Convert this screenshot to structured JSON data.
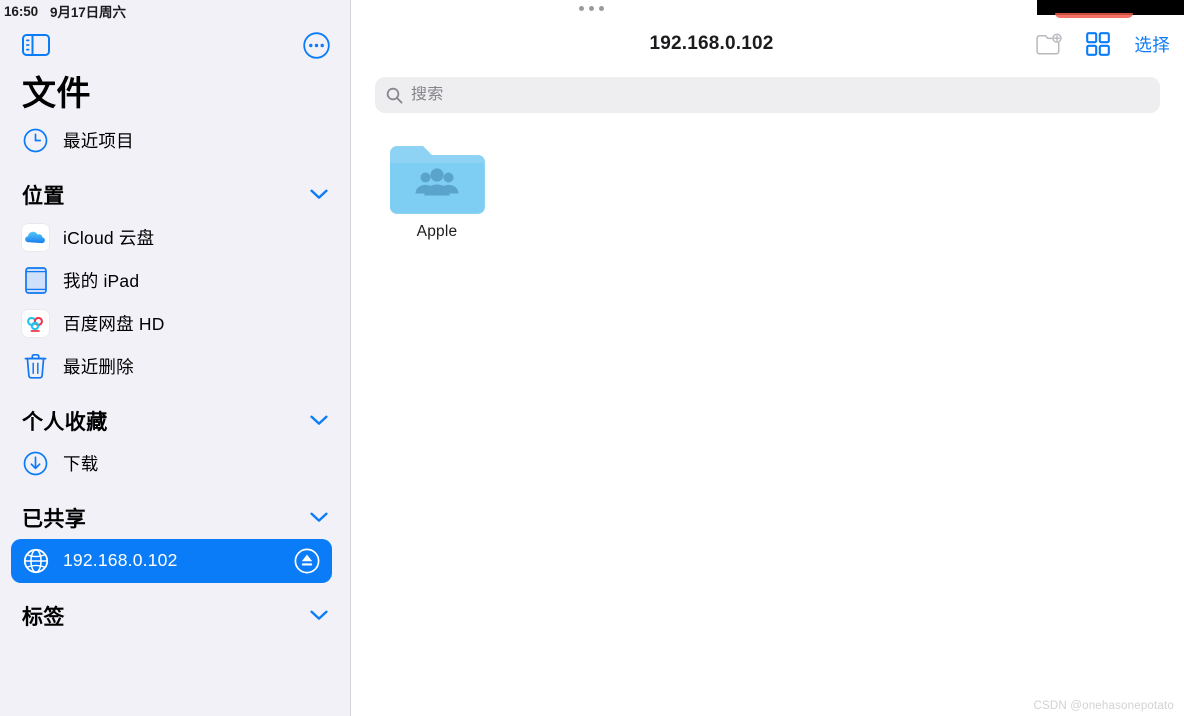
{
  "status_bar": {
    "time": "16:50",
    "date": "9月17日周六"
  },
  "sidebar": {
    "toggle_icon": "sidebar-toggle-icon",
    "more_icon": "more-circle-icon",
    "title": "文件",
    "recent": {
      "label": "最近项目",
      "icon": "clock-icon"
    },
    "sections": [
      {
        "title": "位置",
        "chevron": "chevron-down-icon",
        "items": [
          {
            "label": "iCloud 云盘",
            "icon": "icloud-icon"
          },
          {
            "label": "我的 iPad",
            "icon": "ipad-icon"
          },
          {
            "label": "百度网盘 HD",
            "icon": "baidu-netdisk-icon"
          },
          {
            "label": "最近删除",
            "icon": "trash-icon"
          }
        ]
      },
      {
        "title": "个人收藏",
        "chevron": "chevron-down-icon",
        "items": [
          {
            "label": "下载",
            "icon": "download-circle-icon"
          }
        ]
      },
      {
        "title": "已共享",
        "chevron": "chevron-down-icon",
        "items": [
          {
            "label": "192.168.0.102",
            "icon": "globe-icon",
            "selected": true,
            "trailing_icon": "eject-icon"
          }
        ]
      },
      {
        "title": "标签",
        "chevron": "chevron-down-icon",
        "items": []
      }
    ]
  },
  "main": {
    "title": "192.168.0.102",
    "actions": {
      "new_folder_label": "new-folder-icon",
      "grid_view_label": "grid-view-icon",
      "select_label": "选择"
    },
    "search": {
      "placeholder": "搜索",
      "value": "",
      "icon": "search-icon"
    },
    "files": [
      {
        "name": "Apple",
        "icon": "shared-folder-icon"
      }
    ]
  },
  "watermark": "CSDN @onehasonepotato",
  "colors": {
    "accent_blue": "#0b7cf8",
    "sidebar_bg": "#f2f1f7",
    "folder_blue": "#7ed0f5",
    "search_bg": "#eeeef0"
  }
}
